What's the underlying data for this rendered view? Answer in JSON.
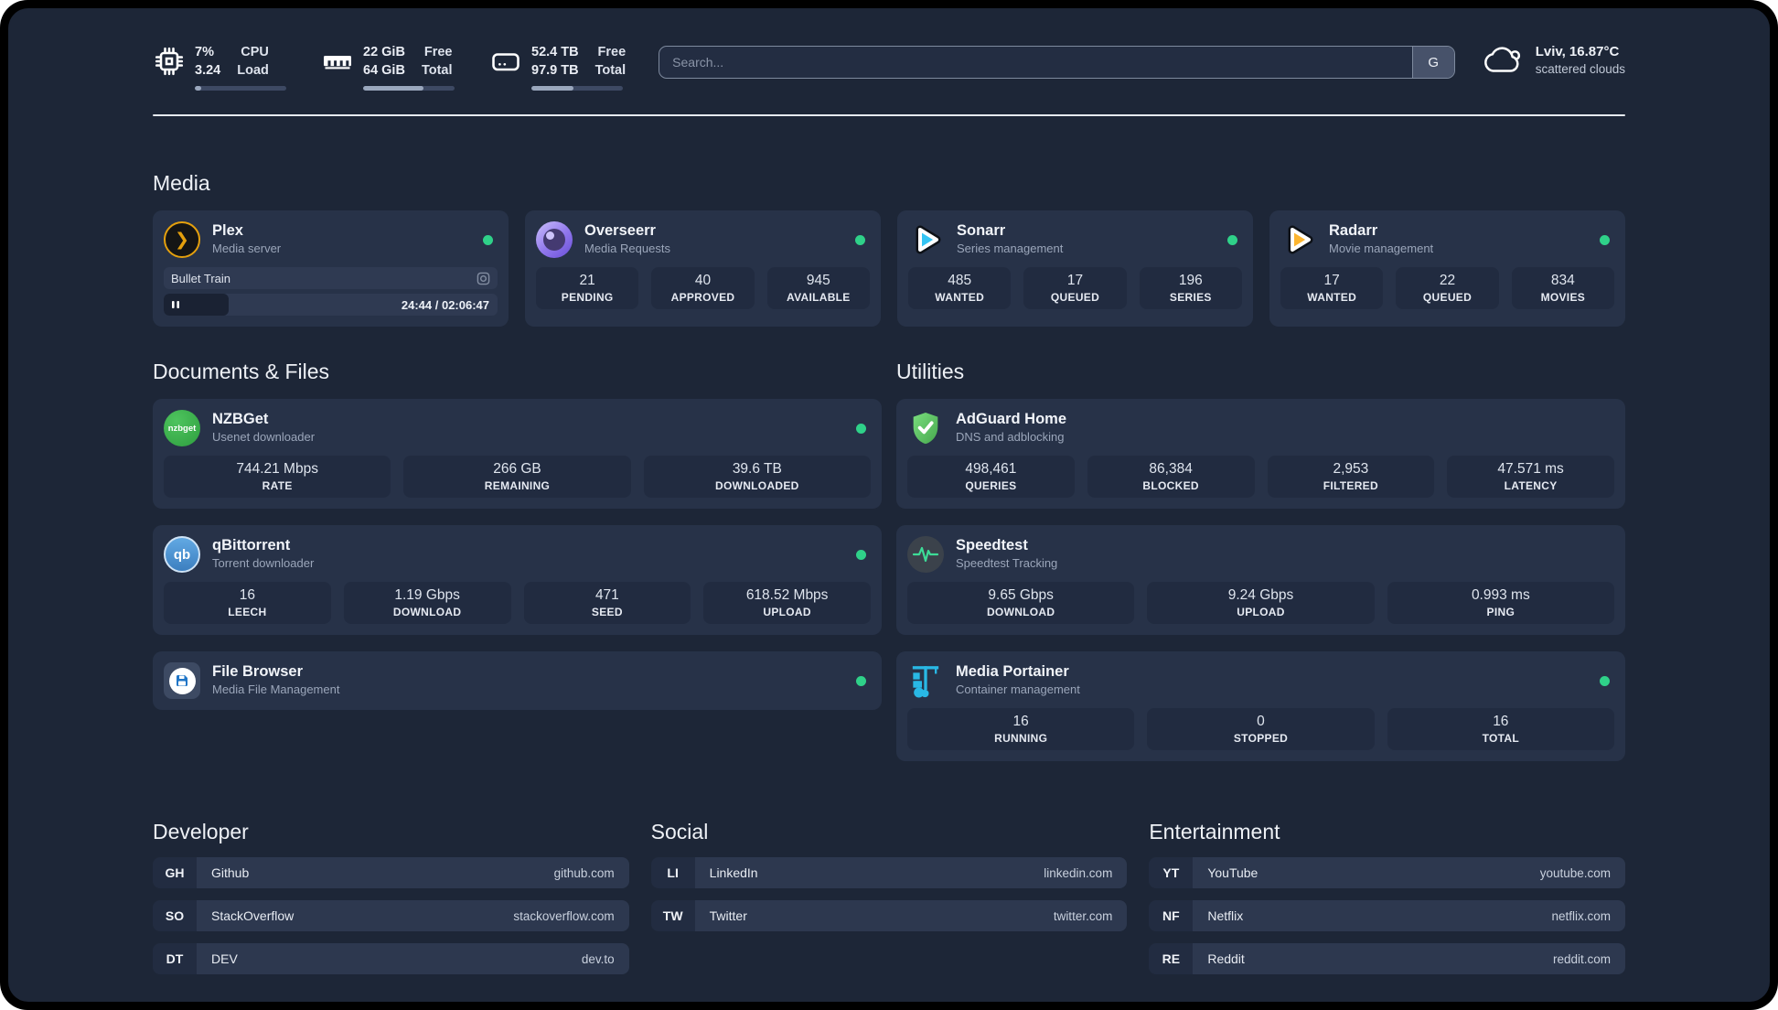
{
  "colors": {
    "page_background": "#1d2637",
    "card_background": "#273248",
    "status_green": "#2fd189",
    "plex_orange": "#e5a00d",
    "sonarr_blue": "#35c5f4",
    "radarr_orange": "#fdb52f",
    "nzbget_green": "#3db54a",
    "adguard_green": "#68d66e",
    "qbittorrent_blue": "#4d90d4",
    "speedtest_green": "#3ddc97",
    "portainer_blue": "#29b8e5",
    "filebrowser_blue": "#2176c7"
  },
  "status_bar": {
    "cpu": {
      "icon": "cpu-icon",
      "values": [
        "7%",
        "3.24"
      ],
      "labels": [
        "CPU",
        "Load"
      ],
      "progress_pct": 7
    },
    "memory": {
      "icon": "memory-icon",
      "values": [
        "22 GiB",
        "64 GiB"
      ],
      "labels": [
        "Free",
        "Total"
      ],
      "progress_pct": 66
    },
    "disk": {
      "icon": "disk-icon",
      "values": [
        "52.4 TB",
        "97.9 TB"
      ],
      "labels": [
        "Free",
        "Total"
      ],
      "progress_pct": 46
    },
    "search": {
      "placeholder": "Search...",
      "provider": "G"
    },
    "weather": {
      "icon": "cloud-icon",
      "line1": "Lviv, 16.87°C",
      "line2": "scattered clouds"
    }
  },
  "media": {
    "title": "Media",
    "apps": [
      {
        "name": "Plex",
        "description": "Media server",
        "icon": "plex-icon",
        "online": true,
        "player": {
          "title": "Bullet Train",
          "time": "24:44 / 02:06:47",
          "progress_pct": 19.5
        }
      },
      {
        "name": "Overseerr",
        "description": "Media Requests",
        "icon": "overseerr-icon",
        "online": true,
        "stats": [
          {
            "value": "21",
            "label": "PENDING"
          },
          {
            "value": "40",
            "label": "APPROVED"
          },
          {
            "value": "945",
            "label": "AVAILABLE"
          }
        ]
      },
      {
        "name": "Sonarr",
        "description": "Series management",
        "icon": "sonarr-icon",
        "online": true,
        "stats": [
          {
            "value": "485",
            "label": "WANTED"
          },
          {
            "value": "17",
            "label": "QUEUED"
          },
          {
            "value": "196",
            "label": "SERIES"
          }
        ]
      },
      {
        "name": "Radarr",
        "description": "Movie management",
        "icon": "radarr-icon",
        "online": true,
        "stats": [
          {
            "value": "17",
            "label": "WANTED"
          },
          {
            "value": "22",
            "label": "QUEUED"
          },
          {
            "value": "834",
            "label": "MOVIES"
          }
        ]
      }
    ]
  },
  "documents": {
    "title": "Documents & Files",
    "apps": [
      {
        "name": "NZBGet",
        "description": "Usenet downloader",
        "icon": "nzbget-icon",
        "online": true,
        "stats": [
          {
            "value": "744.21 Mbps",
            "label": "RATE"
          },
          {
            "value": "266 GB",
            "label": "REMAINING"
          },
          {
            "value": "39.6 TB",
            "label": "DOWNLOADED"
          }
        ]
      },
      {
        "name": "qBittorrent",
        "description": "Torrent downloader",
        "icon": "qbittorrent-icon",
        "online": true,
        "stats": [
          {
            "value": "16",
            "label": "LEECH"
          },
          {
            "value": "1.19 Gbps",
            "label": "DOWNLOAD"
          },
          {
            "value": "471",
            "label": "SEED"
          },
          {
            "value": "618.52 Mbps",
            "label": "UPLOAD"
          }
        ]
      },
      {
        "name": "File Browser",
        "description": "Media File Management",
        "icon": "filebrowser-icon",
        "online": true
      }
    ]
  },
  "utilities": {
    "title": "Utilities",
    "apps": [
      {
        "name": "AdGuard Home",
        "description": "DNS and adblocking",
        "icon": "adguard-icon",
        "online": false,
        "stats": [
          {
            "value": "498,461",
            "label": "QUERIES"
          },
          {
            "value": "86,384",
            "label": "BLOCKED"
          },
          {
            "value": "2,953",
            "label": "FILTERED"
          },
          {
            "value": "47.571 ms",
            "label": "LATENCY"
          }
        ]
      },
      {
        "name": "Speedtest",
        "description": "Speedtest Tracking",
        "icon": "speedtest-icon",
        "online": false,
        "stats": [
          {
            "value": "9.65 Gbps",
            "label": "DOWNLOAD"
          },
          {
            "value": "9.24 Gbps",
            "label": "UPLOAD"
          },
          {
            "value": "0.993 ms",
            "label": "PING"
          }
        ]
      },
      {
        "name": "Media Portainer",
        "description": "Container management",
        "icon": "portainer-icon",
        "online": true,
        "stats": [
          {
            "value": "16",
            "label": "RUNNING"
          },
          {
            "value": "0",
            "label": "STOPPED"
          },
          {
            "value": "16",
            "label": "TOTAL"
          }
        ]
      }
    ]
  },
  "link_sections": [
    {
      "title": "Developer",
      "links": [
        {
          "tag": "GH",
          "name": "Github",
          "url": "github.com"
        },
        {
          "tag": "SO",
          "name": "StackOverflow",
          "url": "stackoverflow.com"
        },
        {
          "tag": "DT",
          "name": "DEV",
          "url": "dev.to"
        }
      ]
    },
    {
      "title": "Social",
      "links": [
        {
          "tag": "LI",
          "name": "LinkedIn",
          "url": "linkedin.com"
        },
        {
          "tag": "TW",
          "name": "Twitter",
          "url": "twitter.com"
        }
      ]
    },
    {
      "title": "Entertainment",
      "links": [
        {
          "tag": "YT",
          "name": "YouTube",
          "url": "youtube.com"
        },
        {
          "tag": "NF",
          "name": "Netflix",
          "url": "netflix.com"
        },
        {
          "tag": "RE",
          "name": "Reddit",
          "url": "reddit.com"
        }
      ]
    }
  ]
}
